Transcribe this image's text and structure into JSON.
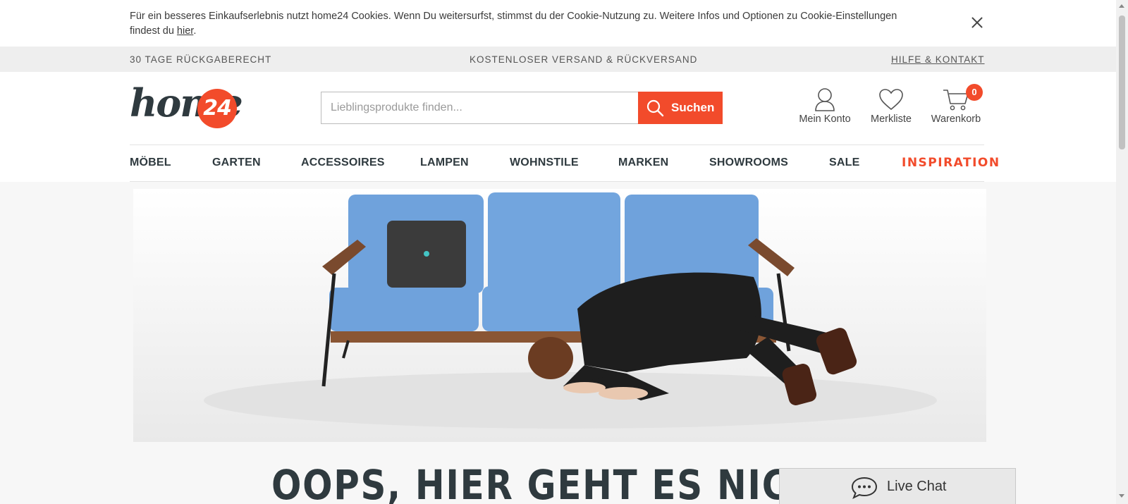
{
  "cookie": {
    "text": "Für ein besseres Einkaufserlebnis nutzt home24 Cookies. Wenn Du weitersurfst, stimmst du der Cookie-Nutzung zu. Weitere Infos und Optionen zu Cookie-Einstellungen findest du ",
    "link": "hier",
    "suffix": "."
  },
  "usp": {
    "left": "30 TAGE RÜCKGABERECHT",
    "center": "KOSTENLOSER VERSAND & RÜCKVERSAND",
    "right": "HILFE & KONTAKT"
  },
  "logo": {
    "word": "home",
    "number": "24"
  },
  "search": {
    "placeholder": "Lieblingsprodukte finden...",
    "button": "Suchen"
  },
  "account": {
    "label": "Mein Konto"
  },
  "wishlist": {
    "label": "Merkliste"
  },
  "cart": {
    "label": "Warenkorb",
    "count": "0"
  },
  "nav": {
    "items": [
      "MÖBEL",
      "GARTEN",
      "ACCESSOIRES",
      "LAMPEN",
      "WOHNSTILE",
      "MARKEN",
      "SHOWROOMS",
      "SALE",
      "INSPIRATION"
    ]
  },
  "headline": "OOPS, HIER GEHT ES NICHT WEITER",
  "chat": {
    "label": "Live Chat"
  },
  "colors": {
    "accent": "#f24b2b",
    "dark": "#2f3a3f",
    "sofa": "#6fa2dc"
  }
}
